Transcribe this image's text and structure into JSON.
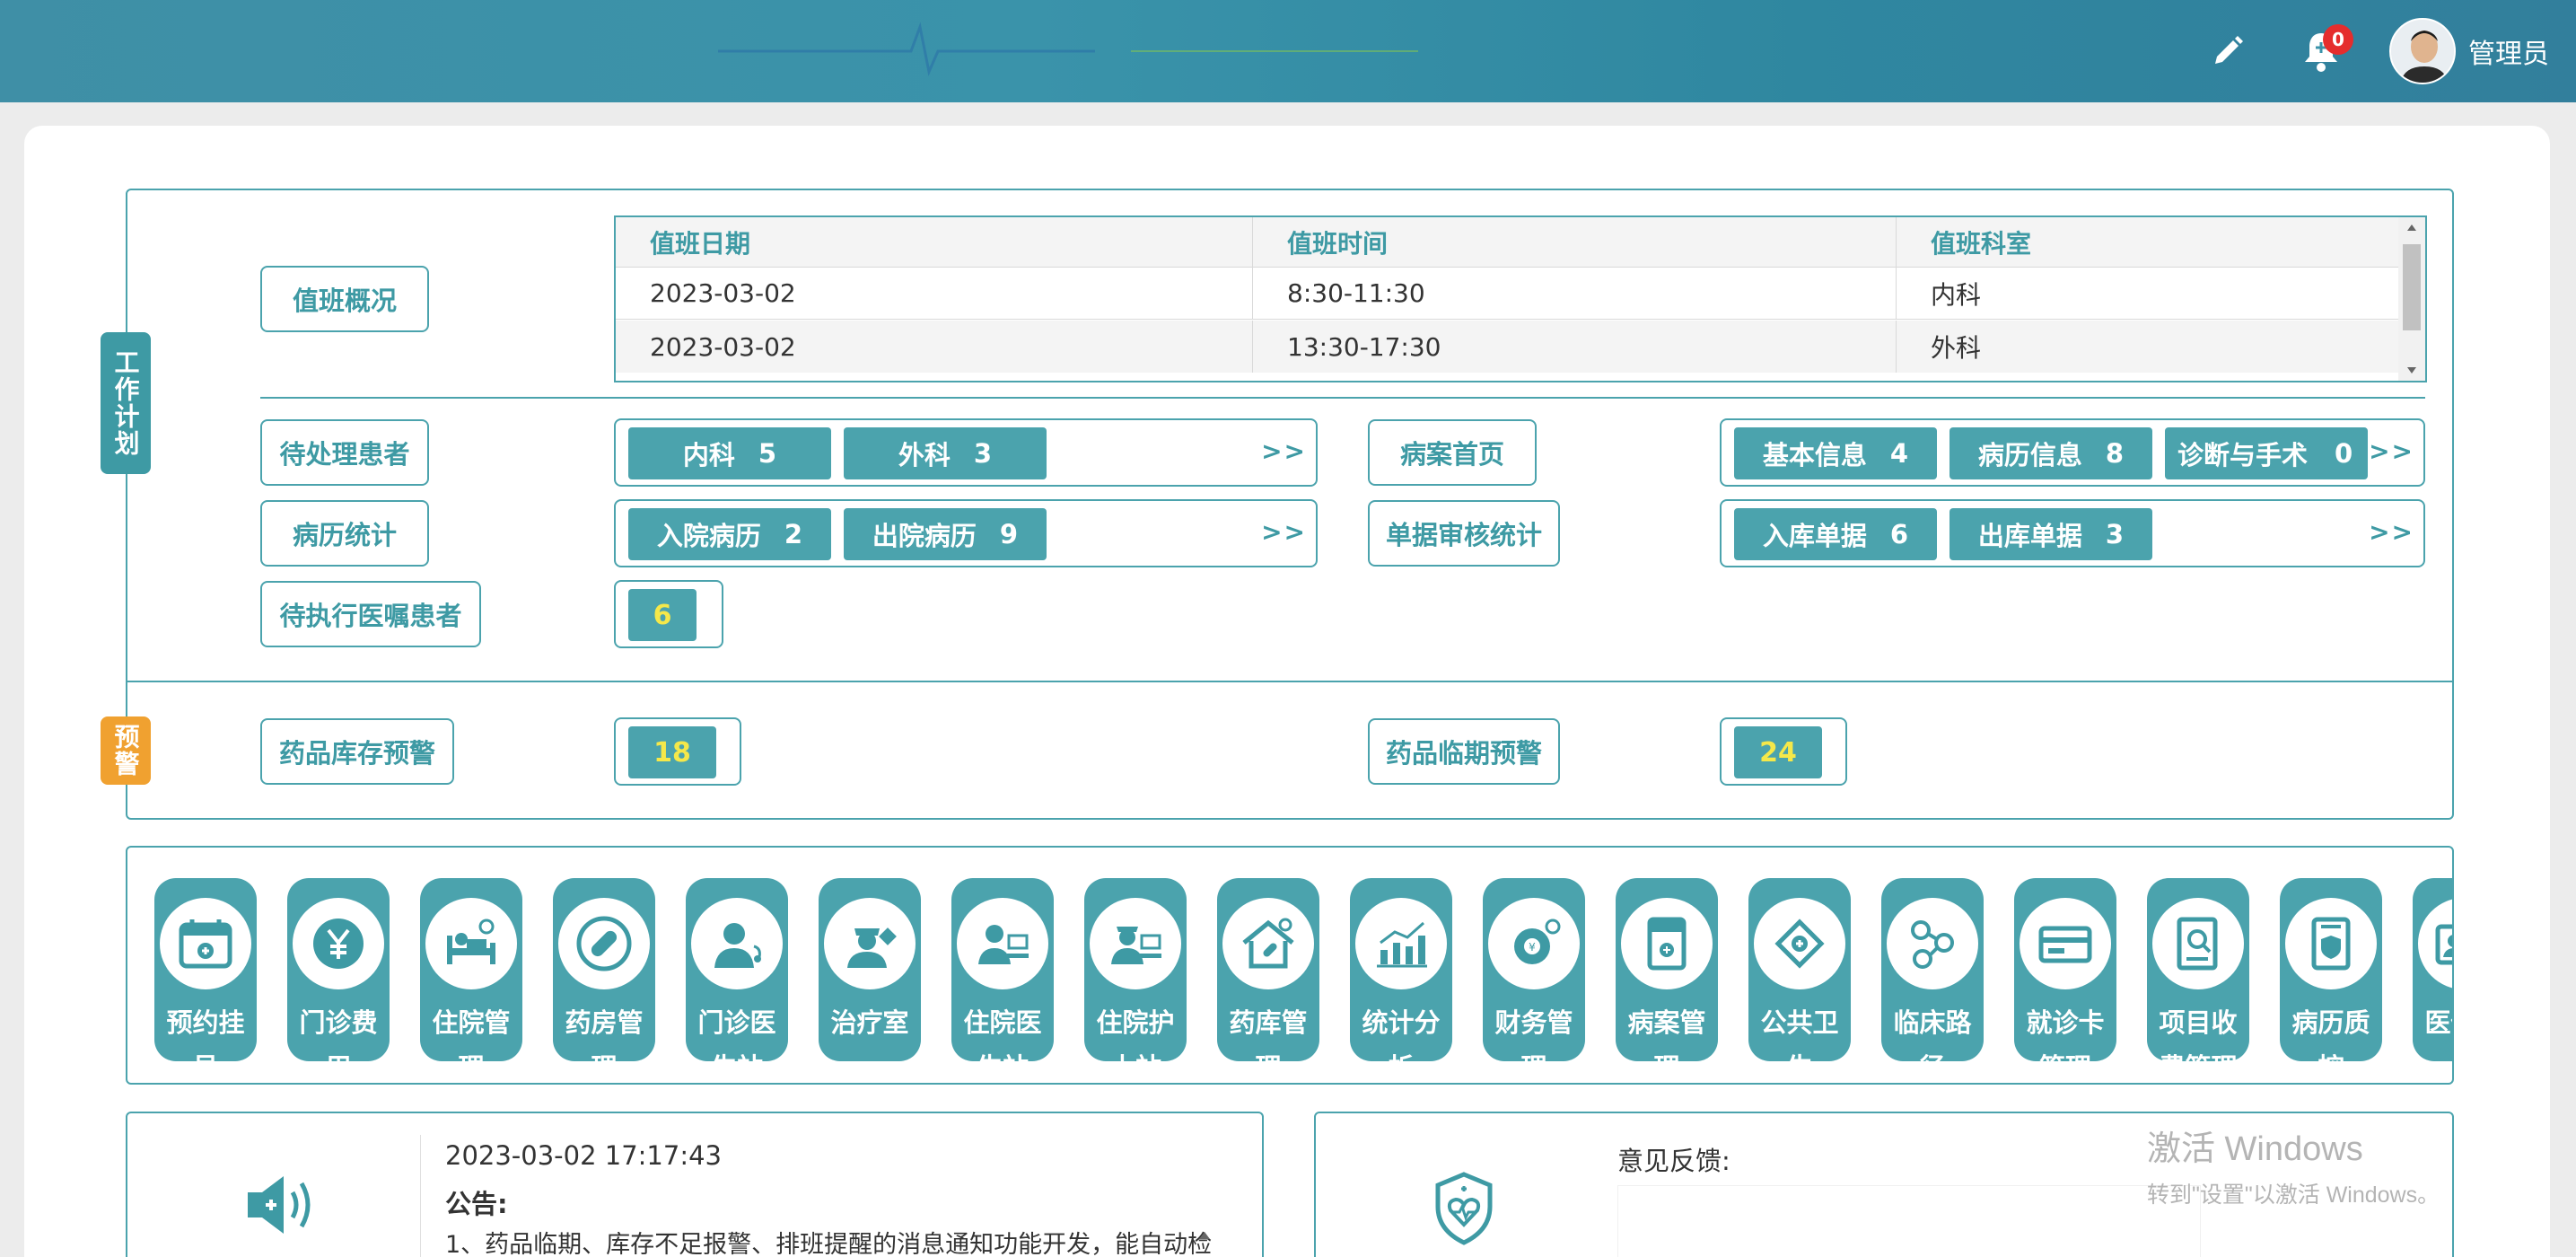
{
  "header": {
    "notification_count": "0",
    "user_name": "管理员"
  },
  "work_plan": {
    "tag": "工作计划",
    "duty_overview_label": "值班概况",
    "duty_table": {
      "headers": [
        "值班日期",
        "值班时间",
        "值班科室"
      ],
      "rows": [
        [
          "2023-03-02",
          "8:30-11:30",
          "内科"
        ],
        [
          "2023-03-02",
          "13:30-17:30",
          "外科"
        ]
      ]
    },
    "pending_patients": {
      "label": "待处理患者",
      "chips": [
        {
          "name": "内科",
          "count": "5"
        },
        {
          "name": "外科",
          "count": "3"
        }
      ],
      "more": ">>"
    },
    "case_home": {
      "label": "病案首页",
      "chips": [
        {
          "name": "基本信息",
          "count": "4"
        },
        {
          "name": "病历信息",
          "count": "8"
        },
        {
          "name": "诊断与手术",
          "count": "0"
        }
      ],
      "more": ">>"
    },
    "record_stats": {
      "label": "病历统计",
      "chips": [
        {
          "name": "入院病历",
          "count": "2"
        },
        {
          "name": "出院病历",
          "count": "9"
        }
      ],
      "more": ">>"
    },
    "doc_review_stats": {
      "label": "单据审核统计",
      "chips": [
        {
          "name": "入库单据",
          "count": "6"
        },
        {
          "name": "出库单据",
          "count": "3"
        }
      ],
      "more": ">>"
    },
    "pending_orders": {
      "label": "待执行医嘱患者",
      "count": "6"
    }
  },
  "warning": {
    "tag": "预警",
    "stock_label": "药品库存预警",
    "stock_count": "18",
    "expiry_label": "药品临期预警",
    "expiry_count": "24"
  },
  "modules": [
    {
      "label": "预约挂号",
      "icon": "calendar-icon"
    },
    {
      "label": "门诊费用",
      "icon": "yen-icon"
    },
    {
      "label": "住院管理",
      "icon": "hospital-bed-icon"
    },
    {
      "label": "药房管理",
      "icon": "pill-icon"
    },
    {
      "label": "门诊医生站",
      "icon": "doctor-icon"
    },
    {
      "label": "治疗室",
      "icon": "nurse-icon"
    },
    {
      "label": "住院医生站",
      "icon": "inpatient-doctor-icon"
    },
    {
      "label": "住院护士站",
      "icon": "inpatient-nurse-icon"
    },
    {
      "label": "药库管理",
      "icon": "pharmacy-house-icon"
    },
    {
      "label": "统计分析",
      "icon": "bar-chart-icon"
    },
    {
      "label": "财务管理",
      "icon": "finance-gear-icon"
    },
    {
      "label": "病案管理",
      "icon": "medical-record-icon"
    },
    {
      "label": "公共卫生",
      "icon": "public-health-icon"
    },
    {
      "label": "临床路径",
      "icon": "clinical-path-icon"
    },
    {
      "label": "就诊卡管理",
      "icon": "card-icon"
    },
    {
      "label": "项目收费管理",
      "icon": "document-search-icon"
    },
    {
      "label": "病历质控",
      "icon": "record-shield-icon"
    },
    {
      "label": "医保业",
      "icon": "insurance-id-icon"
    }
  ],
  "notice": {
    "time": "2023-03-02 17:17:43",
    "title": "公告:",
    "body": "1、药品临期、库存不足报警、排班提醒的消息通知功能开发，能自动检"
  },
  "feedback": {
    "label": "意见反馈:"
  },
  "watermark": {
    "line1": "激活 Windows",
    "line2": "转到\"设置\"以激活 Windows。"
  },
  "colors": {
    "teal": "#4ba3ad",
    "orange": "#f0a130",
    "yellow_count": "#f5e84a",
    "badge_red": "#e52d2d"
  }
}
